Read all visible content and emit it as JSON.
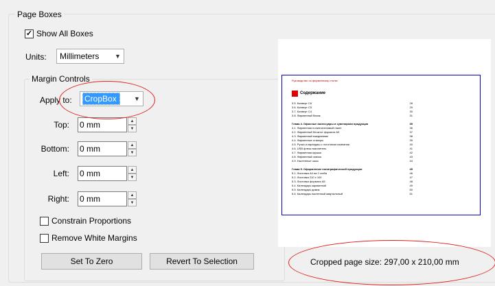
{
  "page_boxes": {
    "title": "Page Boxes",
    "show_all_label": "Show All Boxes",
    "show_all_checked": true,
    "units_label": "Units:",
    "units_value": "Millimeters"
  },
  "margin_controls": {
    "title": "Margin Controls",
    "apply_to_label": "Apply to:",
    "apply_to_value": "CropBox",
    "top_label": "Top:",
    "top_value": "0 mm",
    "bottom_label": "Bottom:",
    "bottom_value": "0 mm",
    "left_label": "Left:",
    "left_value": "0 mm",
    "right_label": "Right:",
    "right_value": "0 mm",
    "constrain_label": "Constrain Proportions",
    "constrain_checked": false,
    "remove_white_label": "Remove White Margins",
    "remove_white_checked": false,
    "set_zero_label": "Set To Zero",
    "revert_label": "Revert To Selection"
  },
  "preview": {
    "doc_header": "Руководство по фирменному стилю",
    "doc_title": "Содержание",
    "toc": [
      {
        "text": "3.5. Конверт C6",
        "page": "28"
      },
      {
        "text": "3.6. Конверт C5",
        "page": "29"
      },
      {
        "text": "3.7. Конверт C4",
        "page": "30"
      },
      {
        "text": "3.8. Фирменный бланк",
        "page": "31"
      },
      {
        "text": "",
        "page": ""
      },
      {
        "text": "Глава 4. Офисные аксессуары и сувенирная продукция",
        "page": "35",
        "section": true
      },
      {
        "text": "4.1. Фирменная полиэтиленовый пакет",
        "page": "36"
      },
      {
        "text": "4.2. Фирменный блокнот формата А5",
        "page": "37"
      },
      {
        "text": "4.3. Фирменный ежедневник",
        "page": "38"
      },
      {
        "text": "4.4. Фирменные стикеры",
        "page": "39"
      },
      {
        "text": "4.5. Ручка и карандаш с логотипом компании",
        "page": "40"
      },
      {
        "text": "4.6. USB флеш накопитель",
        "page": "41"
      },
      {
        "text": "4.7. Фирменная кружка",
        "page": "42"
      },
      {
        "text": "4.8. Фирменный значок",
        "page": "43"
      },
      {
        "text": "4.9. Настенные часы",
        "page": "44"
      },
      {
        "text": "",
        "page": ""
      },
      {
        "text": "Глава 5. Оформление полиграфической продукции",
        "page": "45",
        "section": true
      },
      {
        "text": "5.1. Листовка А4 на 2 сгиба",
        "page": "46"
      },
      {
        "text": "5.2. Листовка 210 x 100",
        "page": "47"
      },
      {
        "text": "5.3. Листовка формата А5",
        "page": "48"
      },
      {
        "text": "5.4. Календарь карманный",
        "page": "49"
      },
      {
        "text": "5.5. Календарь домик",
        "page": "50"
      },
      {
        "text": "5.6. Календарь настенный квартальный",
        "page": "51"
      }
    ],
    "cropped_size_text": "Cropped page size: 297,00 x 210,00 mm"
  },
  "colors": {
    "annotation": "#e02020",
    "selection": "#3399ff",
    "page_border": "#0000cc"
  }
}
